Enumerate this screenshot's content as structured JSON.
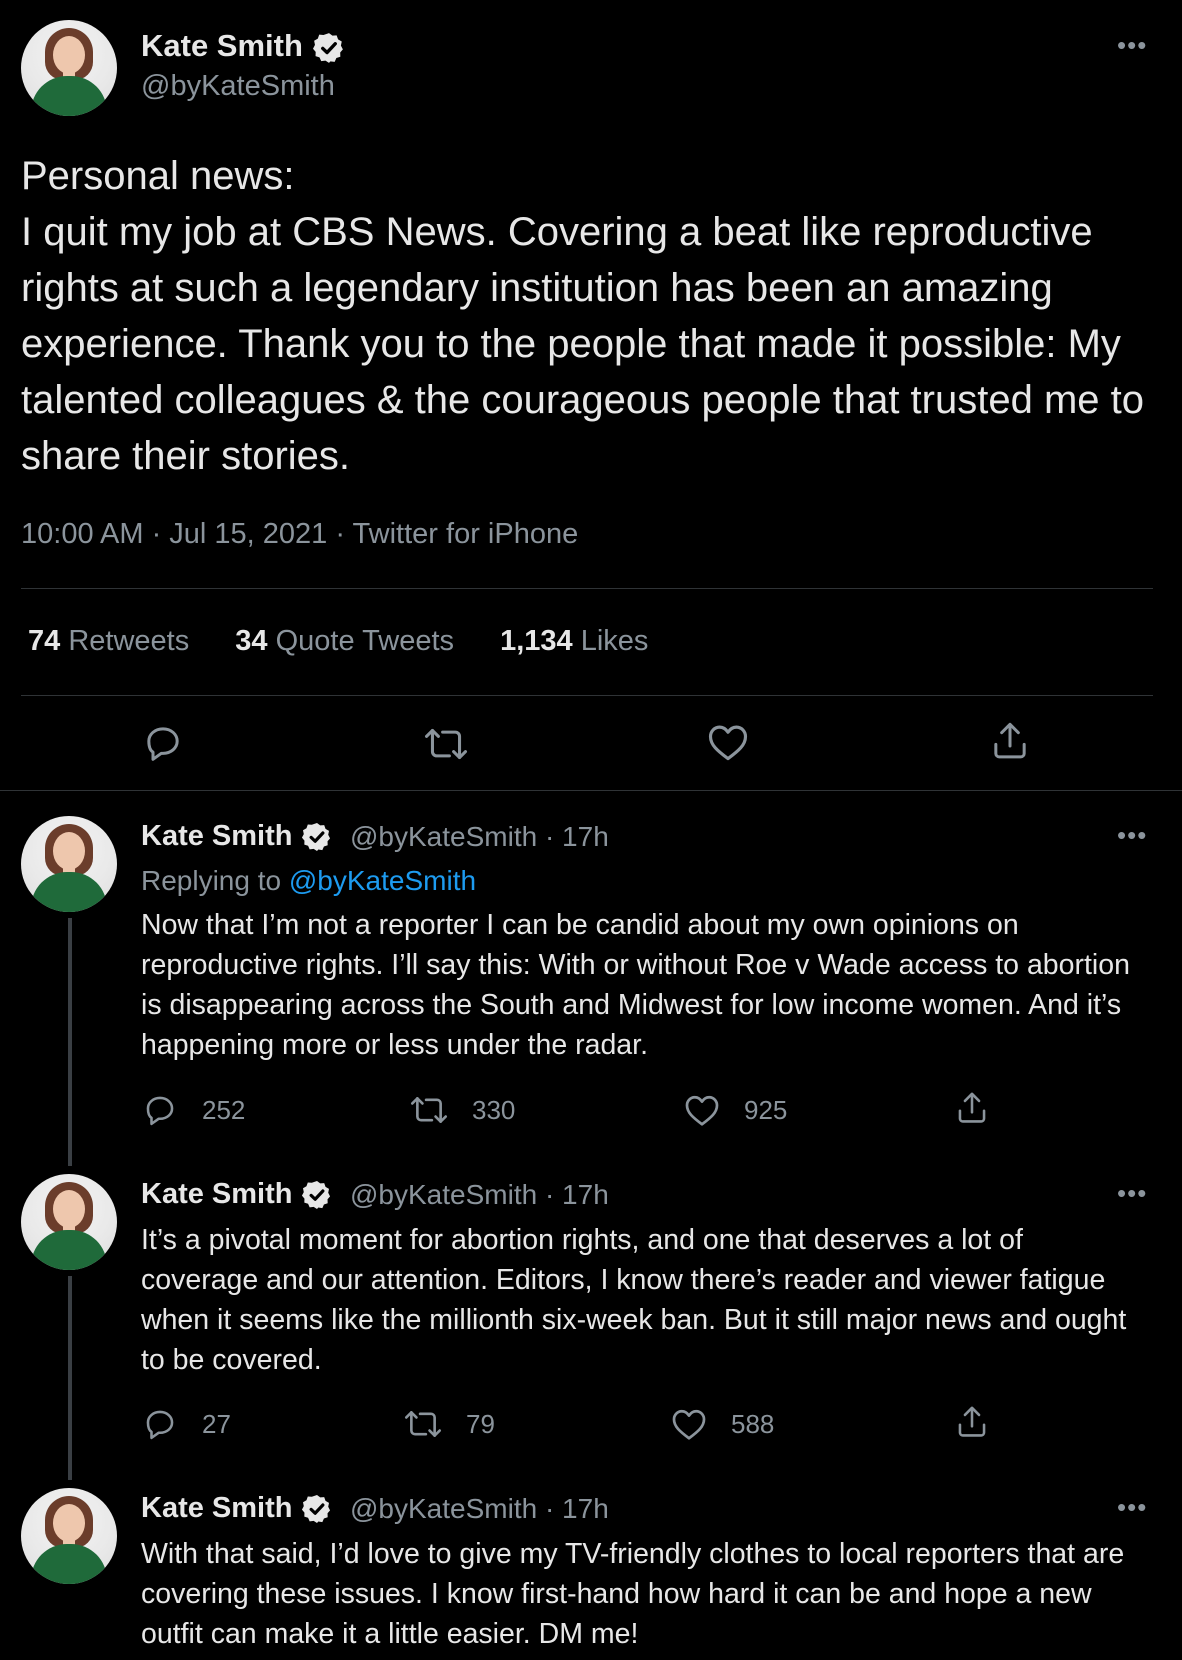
{
  "main_tweet": {
    "author_name": "Kate Smith",
    "author_handle": "@byKateSmith",
    "text": "Personal news:\nI quit my job at CBS News. Covering a beat like reproductive rights at such a legendary institution has been an amazing experience. Thank you to the people that made it possible: My talented colleagues & the courageous people that trusted me to share their stories.",
    "meta": "10:00 AM · Jul 15, 2021 · Twitter for iPhone",
    "stats": {
      "retweets_count": "74",
      "retweets_label": "Retweets",
      "quotes_count": "34",
      "quotes_label": "Quote Tweets",
      "likes_count": "1,134",
      "likes_label": "Likes"
    },
    "more_icon": "more-horizontal-icon"
  },
  "replies": [
    {
      "author_name": "Kate Smith",
      "meta": "@byKateSmith · 17h",
      "replying_prefix": "Replying to",
      "replying_handle": "@byKateSmith",
      "text": "Now that I’m not a reporter I can be candid about my own opinions on reproductive rights. I’ll say this: With or without Roe v Wade access to abortion is disappearing across the South and Midwest for low income women. And it’s happening more or less under the radar.",
      "reply_count": "252",
      "retweet_count": "330",
      "like_count": "925"
    },
    {
      "author_name": "Kate Smith",
      "meta": "@byKateSmith · 17h",
      "text": "It’s a pivotal moment for abortion rights, and one that deserves a lot of coverage and our attention. Editors, I know there’s reader and viewer fatigue when it seems like the millionth six-week ban. But it still major news and ought to be covered.",
      "reply_count": "27",
      "retweet_count": "79",
      "like_count": "588"
    },
    {
      "author_name": "Kate Smith",
      "meta": "@byKateSmith · 17h",
      "text": "With that said, I’d love to give my TV-friendly clothes to local reporters that are covering these issues. I know first-hand how hard it can be and hope a new outfit can make it a little easier. DM me!"
    }
  ],
  "colors": {
    "background": "#000000",
    "text": "#e7e7e7",
    "muted": "#8b949c",
    "link": "#1d9bf0",
    "divider": "#2f3336"
  }
}
